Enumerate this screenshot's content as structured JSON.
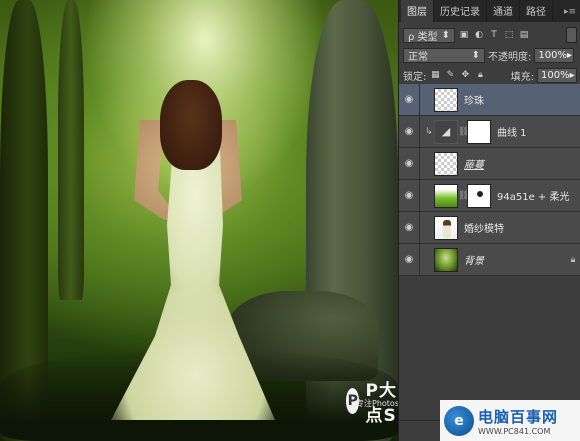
{
  "panel": {
    "tabs": [
      {
        "label": "图层",
        "active": true
      },
      {
        "label": "历史记录",
        "active": false
      },
      {
        "label": "通道",
        "active": false
      },
      {
        "label": "路径",
        "active": false
      }
    ],
    "filter": {
      "value": "ρ 类型"
    },
    "blend": {
      "mode": "正常",
      "opacity_label": "不透明度:",
      "opacity_value": "100%"
    },
    "lock": {
      "label": "锁定:",
      "fill_label": "填充:",
      "fill_value": "100%"
    },
    "layers": [
      {
        "name": "珍珠",
        "selected": true,
        "thumb": "checker"
      },
      {
        "name": "曲线 1",
        "selected": false,
        "thumb": "adjustment"
      },
      {
        "name": "藤蔓",
        "selected": false,
        "thumb": "checker"
      },
      {
        "name": "94a51e + 柔光",
        "selected": false,
        "thumb": "tree"
      },
      {
        "name": "婚纱模特",
        "selected": false,
        "thumb": "person"
      },
      {
        "name": "背景",
        "selected": false,
        "thumb": "photo"
      }
    ]
  },
  "watermark": {
    "title": "P大点S",
    "subtitle": "专注Photoshop教程"
  },
  "site_banner": {
    "name": "电脑百事网",
    "url": "WWW.PC841.COM"
  },
  "colors": {
    "panel_bg": "#3d3d3d",
    "selected_layer": "#566273",
    "site_blue": "#1a5fb4"
  }
}
